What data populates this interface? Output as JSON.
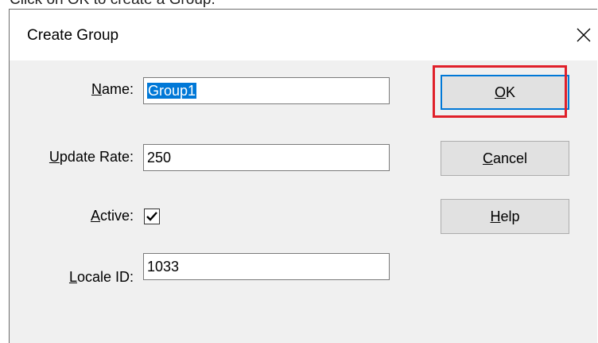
{
  "caption": "Click on OK to create a Group.",
  "dialog": {
    "title": "Create Group",
    "close_icon": "close-icon"
  },
  "form": {
    "name": {
      "label_u": "N",
      "label_rest": "ame:",
      "value": "Group1"
    },
    "update_rate": {
      "label_u": "U",
      "label_rest": "pdate Rate:",
      "value": "250"
    },
    "active": {
      "label_u": "A",
      "label_rest": "ctive:",
      "checked": true
    },
    "locale_id": {
      "label_u": "L",
      "label_rest": "ocale ID:",
      "value": "1033"
    }
  },
  "buttons": {
    "ok": {
      "u": "O",
      "rest": "K"
    },
    "cancel": {
      "u": "C",
      "rest": "ancel"
    },
    "help": {
      "u": "H",
      "rest": "elp"
    }
  },
  "colors": {
    "highlight": "#e0202a",
    "selection": "#0078d7"
  }
}
